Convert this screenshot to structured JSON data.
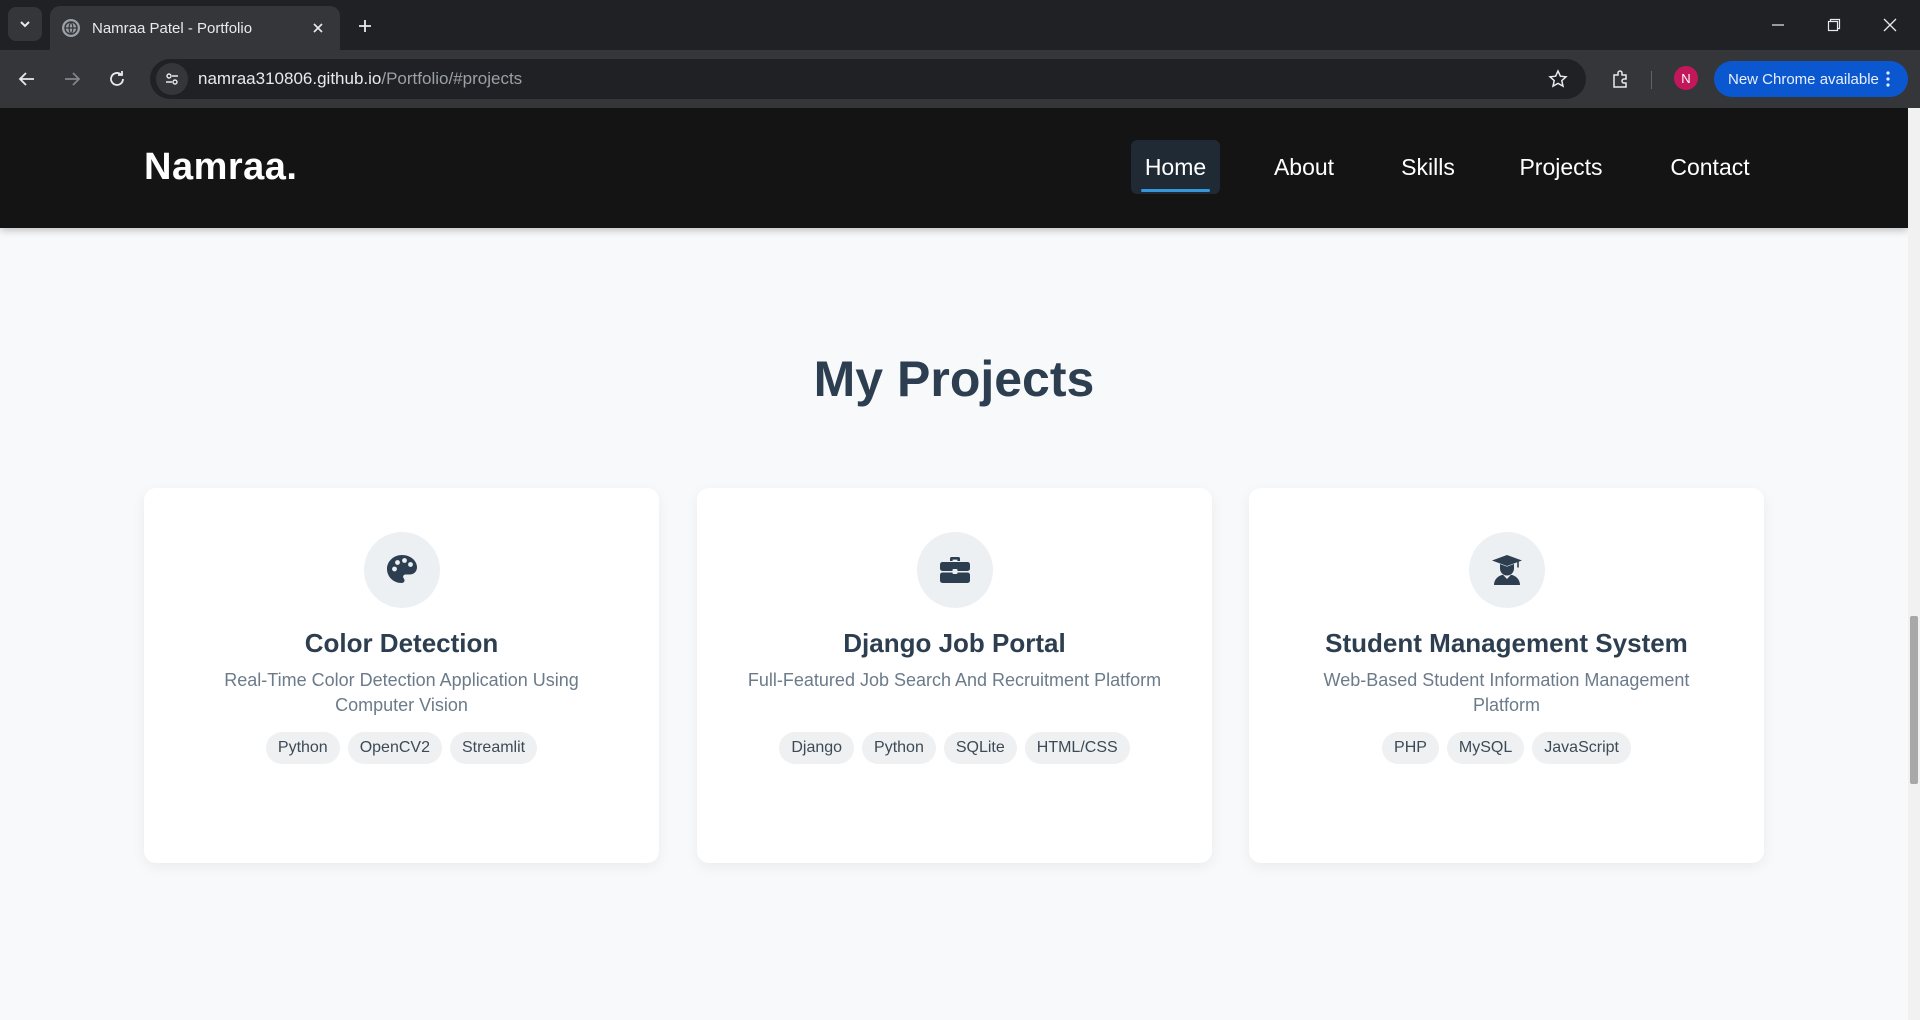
{
  "browser": {
    "tab_title": "Namraa Patel - Portfolio",
    "url_host": "namraa310806.github.io",
    "url_path": "/Portfolio/#projects",
    "profile_initial": "N",
    "update_label": "New Chrome available",
    "accent_color": "#0b57d0"
  },
  "site": {
    "logo": "Namraa.",
    "nav": [
      {
        "label": "Home",
        "active": true
      },
      {
        "label": "About",
        "active": false
      },
      {
        "label": "Skills",
        "active": false
      },
      {
        "label": "Projects",
        "active": false
      },
      {
        "label": "Contact",
        "active": false
      }
    ],
    "nav_accent_color": "#3498db"
  },
  "projects": {
    "heading": "My Projects",
    "items": [
      {
        "icon": "palette-icon",
        "title": "Color Detection",
        "description": "Real-Time Color Detection Application Using Computer Vision",
        "tags": [
          "Python",
          "OpenCV2",
          "Streamlit"
        ]
      },
      {
        "icon": "briefcase-icon",
        "title": "Django Job Portal",
        "description": "Full-Featured Job Search And Recruitment Platform",
        "tags": [
          "Django",
          "Python",
          "SQLite",
          "HTML/CSS"
        ]
      },
      {
        "icon": "graduate-icon",
        "title": "Student Management System",
        "description": "Web-Based Student Information Management Platform",
        "tags": [
          "PHP",
          "MySQL",
          "JavaScript"
        ]
      }
    ]
  }
}
